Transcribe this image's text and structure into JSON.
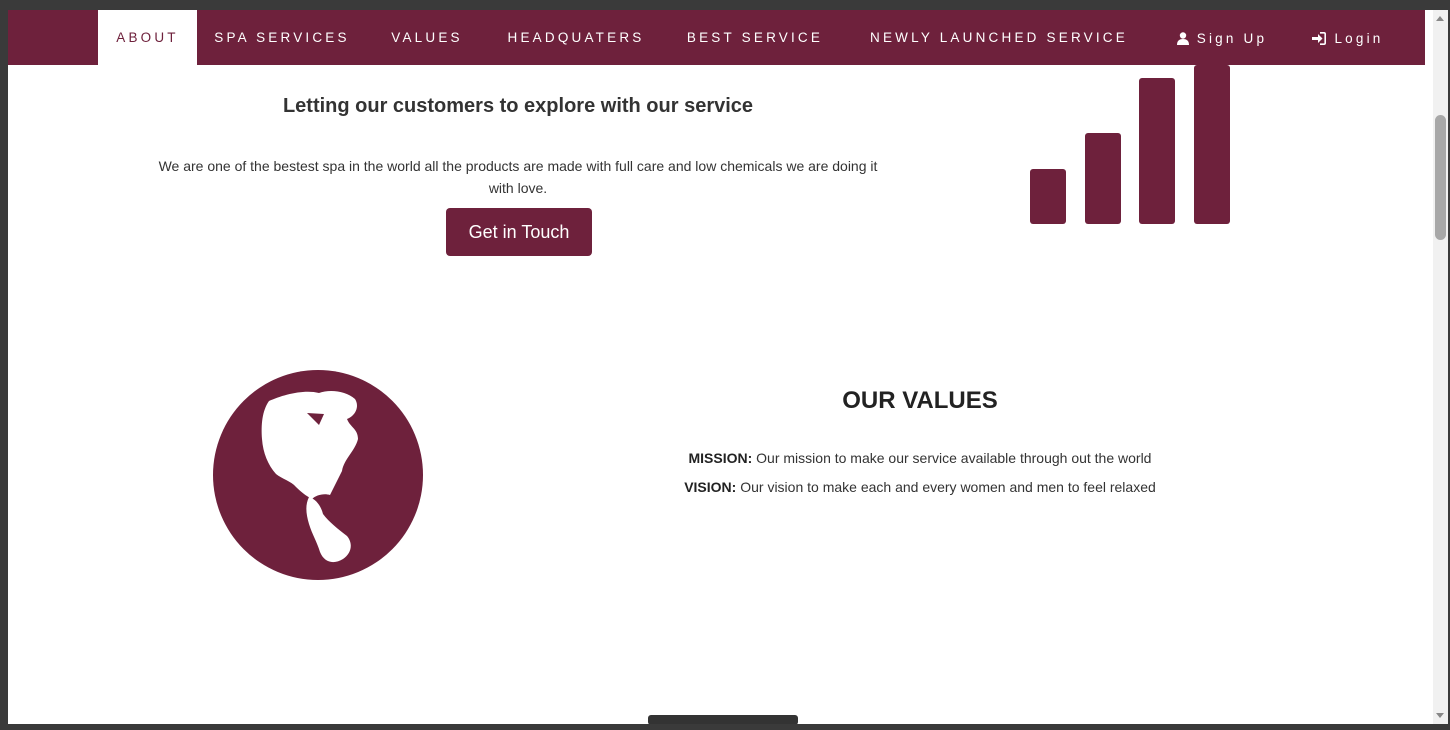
{
  "colors": {
    "brand": "#6e213c",
    "background": "#ffffff"
  },
  "nav": {
    "items": [
      {
        "label": "ABOUT",
        "active": true
      },
      {
        "label": "SPA SERVICES"
      },
      {
        "label": "VALUES"
      },
      {
        "label": "HEADQUATERS"
      },
      {
        "label": "BEST SERVICE"
      },
      {
        "label": "NEWLY LAUNCHED SERVICE"
      }
    ],
    "signup": {
      "label": "Sign Up",
      "icon": "user-icon"
    },
    "login": {
      "label": "Login",
      "icon": "login-icon"
    }
  },
  "hero": {
    "title": "Letting our customers to explore with our service",
    "description": "We are one of the bestest spa in the world all the products are made with full care and low chemicals we are doing it with love.",
    "button_label": "Get in Touch",
    "icon": "signal-bars-icon"
  },
  "values": {
    "icon": "globe-icon",
    "title": "OUR VALUES",
    "mission_label": "MISSION:",
    "mission_text": " Our mission to make our service available through out the world",
    "vision_label": "VISION:",
    "vision_text": " Our vision to make each and every women and men to feel relaxed"
  }
}
